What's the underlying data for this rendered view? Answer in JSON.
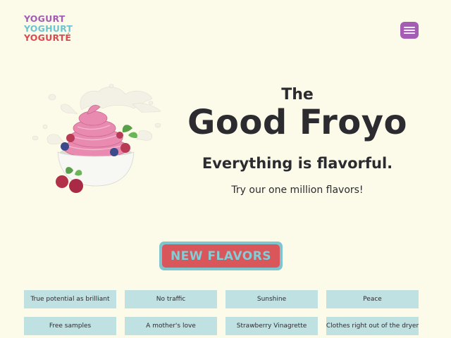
{
  "logo": {
    "line1": "YOGURT",
    "line2": "YOGHURT",
    "line3": "YOGURTÉ",
    "colors": [
      "#a45cb4",
      "#6fc4d1",
      "#d84b50"
    ]
  },
  "menu": {
    "icon": "hamburger-menu-icon",
    "color": "#a45cb4"
  },
  "hero": {
    "image": "frozen-yogurt-bowl-with-berries",
    "title_small": "The",
    "title_large": "Good Froyo",
    "subtitle": "Everything is flavorful.",
    "tagline": "Try our one million flavors!"
  },
  "cta": {
    "label": "NEW FLAVORS",
    "color": "#d9565a",
    "border_color": "#7fc5cf"
  },
  "flavors": [
    "True potential as brilliant",
    "No traffic",
    "Sunshine",
    "Peace",
    "Free samples",
    "A mother's love",
    "Strawberry Vinagrette",
    "Clothes right out of the dryer"
  ],
  "colors": {
    "background": "#fcfbea",
    "chip": "#bfe1e2",
    "text": "#2b2b30"
  }
}
